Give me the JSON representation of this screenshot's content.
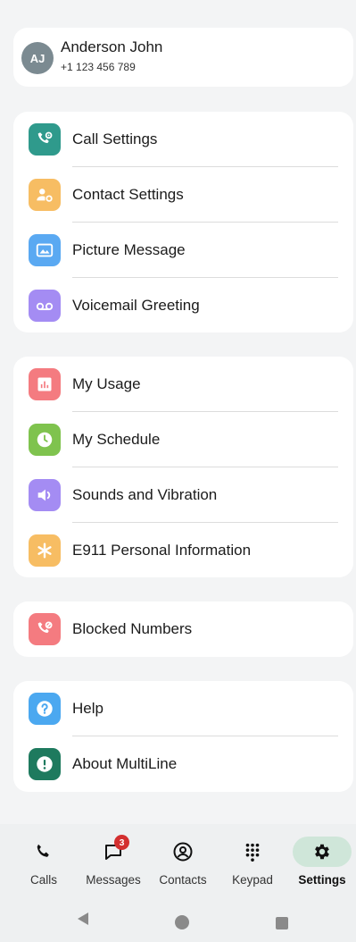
{
  "profile": {
    "initials": "AJ",
    "name": "Anderson John",
    "number": "+1 123 456 789"
  },
  "groups": [
    [
      {
        "label": "Call Settings",
        "icon": "phone-settings-icon",
        "color": "#2f9a8c"
      },
      {
        "label": "Contact Settings",
        "icon": "contact-settings-icon",
        "color": "#f7bd63"
      },
      {
        "label": "Picture Message",
        "icon": "picture-icon",
        "color": "#5aa9f2"
      },
      {
        "label": "Voicemail Greeting",
        "icon": "voicemail-icon",
        "color": "#a48cf3"
      }
    ],
    [
      {
        "label": "My Usage",
        "icon": "usage-chart-icon",
        "color": "#f47b80"
      },
      {
        "label": "My Schedule",
        "icon": "clock-icon",
        "color": "#7fc34e"
      },
      {
        "label": "Sounds and Vibration",
        "icon": "speaker-icon",
        "color": "#a48cf3"
      },
      {
        "label": "E911 Personal Information",
        "icon": "asterisk-icon",
        "color": "#f7bd63"
      }
    ],
    [
      {
        "label": "Blocked Numbers",
        "icon": "blocked-phone-icon",
        "color": "#f47b80"
      }
    ],
    [
      {
        "label": "Help",
        "icon": "help-icon",
        "color": "#4ba8f0"
      },
      {
        "label": "About MultiLine",
        "icon": "info-icon",
        "color": "#1e7a5e"
      }
    ]
  ],
  "nav": [
    {
      "label": "Calls",
      "icon": "phone-icon"
    },
    {
      "label": "Messages",
      "icon": "message-icon",
      "badge": "3"
    },
    {
      "label": "Contacts",
      "icon": "contact-icon"
    },
    {
      "label": "Keypad",
      "icon": "keypad-icon"
    },
    {
      "label": "Settings",
      "icon": "gear-icon",
      "active": true
    }
  ],
  "colors": {
    "nav_active_bg": "#cfe6d9",
    "badge": "#d32f2f"
  }
}
